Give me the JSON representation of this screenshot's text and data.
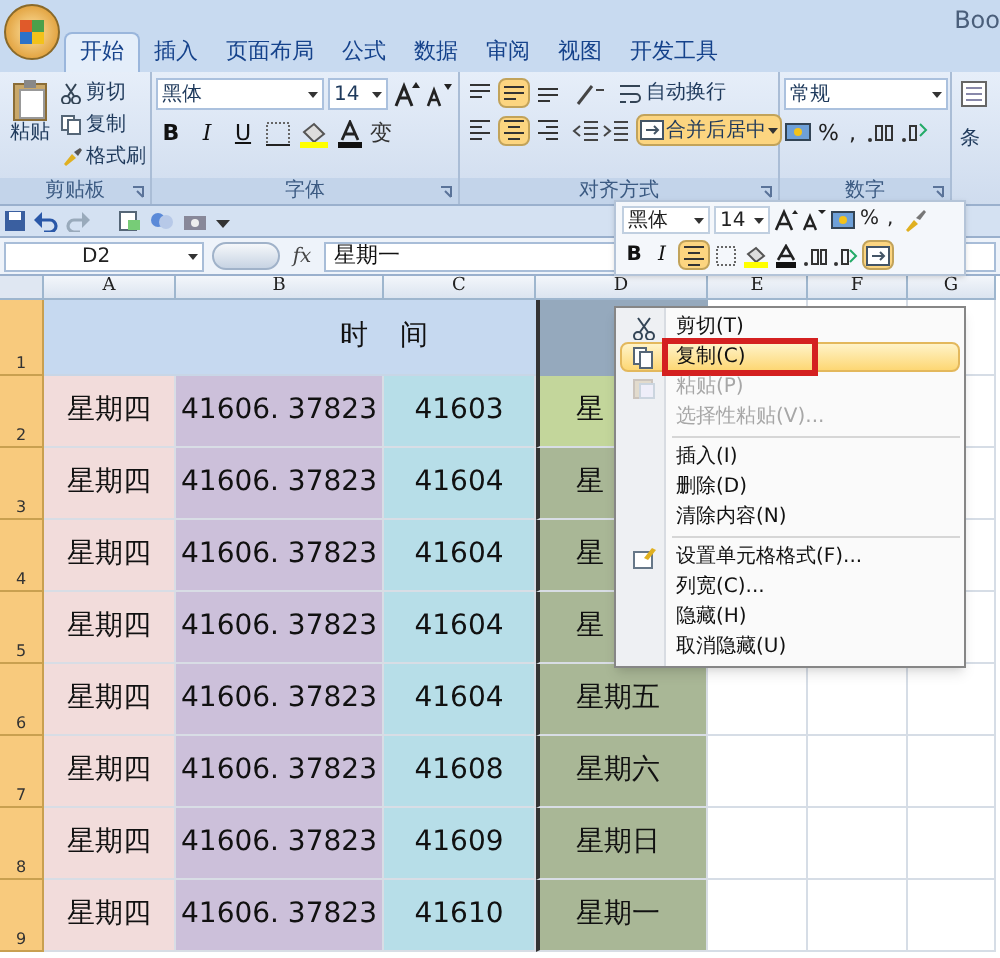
{
  "title": "Boo",
  "tabs": [
    {
      "label": "开始",
      "selected": true
    },
    {
      "label": "插入",
      "selected": false
    },
    {
      "label": "页面布局",
      "selected": false
    },
    {
      "label": "公式",
      "selected": false
    },
    {
      "label": "数据",
      "selected": false
    },
    {
      "label": "审阅",
      "selected": false
    },
    {
      "label": "视图",
      "selected": false
    },
    {
      "label": "开发工具",
      "selected": false
    }
  ],
  "clipboard": {
    "paste": "粘贴",
    "cut": "剪切",
    "copy": "复制",
    "format_painter": "格式刷",
    "label": "剪贴板"
  },
  "font": {
    "name": "黑体",
    "size": "14",
    "bold": "B",
    "italic": "I",
    "underline": "U",
    "phonetic": "变",
    "label": "字体"
  },
  "alignment": {
    "vertical": [
      {
        "selected": false
      },
      {
        "selected": true
      },
      {
        "selected": false
      }
    ],
    "horizontal": [
      {
        "selected": false
      },
      {
        "selected": true
      },
      {
        "selected": false
      }
    ],
    "wrap": "自动换行",
    "merge": {
      "label": "合并后居中",
      "selected": true
    },
    "label": "对齐方式"
  },
  "number": {
    "format": "常规",
    "percent": "%",
    "comma": ",",
    "label": "数字"
  },
  "next_group": {
    "label": "条"
  },
  "formula_bar": {
    "name_box": "D2",
    "fx": "fx",
    "value": "星期一"
  },
  "mini_toolbar": {
    "font": "黑体",
    "size": "14",
    "percent": "%",
    "comma": ",",
    "bold": "B",
    "italic": "I",
    "center_selected": true,
    "merge_selected": true
  },
  "columns": [
    {
      "header": "A"
    },
    {
      "header": "B"
    },
    {
      "header": "C"
    },
    {
      "header": "D"
    },
    {
      "header": "E"
    },
    {
      "header": "F"
    },
    {
      "header": "G"
    }
  ],
  "header_row": {
    "number": "1",
    "selected": true,
    "left": "时",
    "right": "间"
  },
  "rows": [
    {
      "number": "2",
      "selected": true,
      "cells": [
        {
          "text": "星期四",
          "color": "#f2dcdb"
        },
        {
          "text": "41606. 37823",
          "color": "#ccc0da"
        },
        {
          "text": "41603",
          "color": "#b7dee8"
        },
        {
          "text": "星",
          "color": "#c3d69b"
        }
      ]
    },
    {
      "number": "3",
      "selected": true,
      "cells": [
        {
          "text": "星期四",
          "color": "#f2dcdb"
        },
        {
          "text": "41606. 37823",
          "color": "#ccc0da"
        },
        {
          "text": "41604",
          "color": "#b7dee8"
        },
        {
          "text": "星",
          "color": "#a9b796"
        }
      ]
    },
    {
      "number": "4",
      "selected": true,
      "cells": [
        {
          "text": "星期四",
          "color": "#f2dcdb"
        },
        {
          "text": "41606. 37823",
          "color": "#ccc0da"
        },
        {
          "text": "41604",
          "color": "#b7dee8"
        },
        {
          "text": "星",
          "color": "#a9b796"
        }
      ]
    },
    {
      "number": "5",
      "selected": true,
      "cells": [
        {
          "text": "星期四",
          "color": "#f2dcdb"
        },
        {
          "text": "41606. 37823",
          "color": "#ccc0da"
        },
        {
          "text": "41604",
          "color": "#b7dee8"
        },
        {
          "text": "星",
          "color": "#a9b796"
        }
      ]
    },
    {
      "number": "6",
      "selected": true,
      "cells": [
        {
          "text": "星期四",
          "color": "#f2dcdb"
        },
        {
          "text": "41606. 37823",
          "color": "#ccc0da"
        },
        {
          "text": "41604",
          "color": "#b7dee8"
        },
        {
          "text": "星期五",
          "color": "#a9b796"
        }
      ]
    },
    {
      "number": "7",
      "selected": true,
      "cells": [
        {
          "text": "星期四",
          "color": "#f2dcdb"
        },
        {
          "text": "41606. 37823",
          "color": "#ccc0da"
        },
        {
          "text": "41608",
          "color": "#b7dee8"
        },
        {
          "text": "星期六",
          "color": "#a9b796"
        }
      ]
    },
    {
      "number": "8",
      "selected": true,
      "cells": [
        {
          "text": "星期四",
          "color": "#f2dcdb"
        },
        {
          "text": "41606. 37823",
          "color": "#ccc0da"
        },
        {
          "text": "41609",
          "color": "#b7dee8"
        },
        {
          "text": "星期日",
          "color": "#a9b796"
        }
      ]
    },
    {
      "number": "9",
      "selected": true,
      "cells": [
        {
          "text": "星期四",
          "color": "#f2dcdb"
        },
        {
          "text": "41606. 37823",
          "color": "#ccc0da"
        },
        {
          "text": "41610",
          "color": "#b7dee8"
        },
        {
          "text": "星期一",
          "color": "#a9b796"
        }
      ]
    }
  ],
  "context_menu": [
    {
      "kind": "cut",
      "label": "剪切(T)",
      "selected": false,
      "disabled": false,
      "outlined": false,
      "separator_after": false
    },
    {
      "kind": "copy",
      "label": "复制(C)",
      "selected": true,
      "disabled": false,
      "outlined": true,
      "separator_after": false
    },
    {
      "kind": "paste",
      "label": "粘贴(P)",
      "selected": false,
      "disabled": true,
      "outlined": false,
      "separator_after": false
    },
    {
      "kind": "plain",
      "label": "选择性粘贴(V)...",
      "selected": false,
      "disabled": true,
      "outlined": false,
      "separator_after": true
    },
    {
      "kind": "plain",
      "label": "插入(I)",
      "selected": false,
      "disabled": false,
      "outlined": false,
      "separator_after": false
    },
    {
      "kind": "plain",
      "label": "删除(D)",
      "selected": false,
      "disabled": false,
      "outlined": false,
      "separator_after": false
    },
    {
      "kind": "plain",
      "label": "清除内容(N)",
      "selected": false,
      "disabled": false,
      "outlined": false,
      "separator_after": true
    },
    {
      "kind": "format",
      "label": "设置单元格格式(F)...",
      "selected": false,
      "disabled": false,
      "outlined": false,
      "separator_after": false
    },
    {
      "kind": "plain",
      "label": "列宽(C)...",
      "selected": false,
      "disabled": false,
      "outlined": false,
      "separator_after": false
    },
    {
      "kind": "plain",
      "label": "隐藏(H)",
      "selected": false,
      "disabled": false,
      "outlined": false,
      "separator_after": false
    },
    {
      "kind": "plain",
      "label": "取消隐藏(U)",
      "selected": false,
      "disabled": false,
      "outlined": false,
      "separator_after": false
    }
  ]
}
